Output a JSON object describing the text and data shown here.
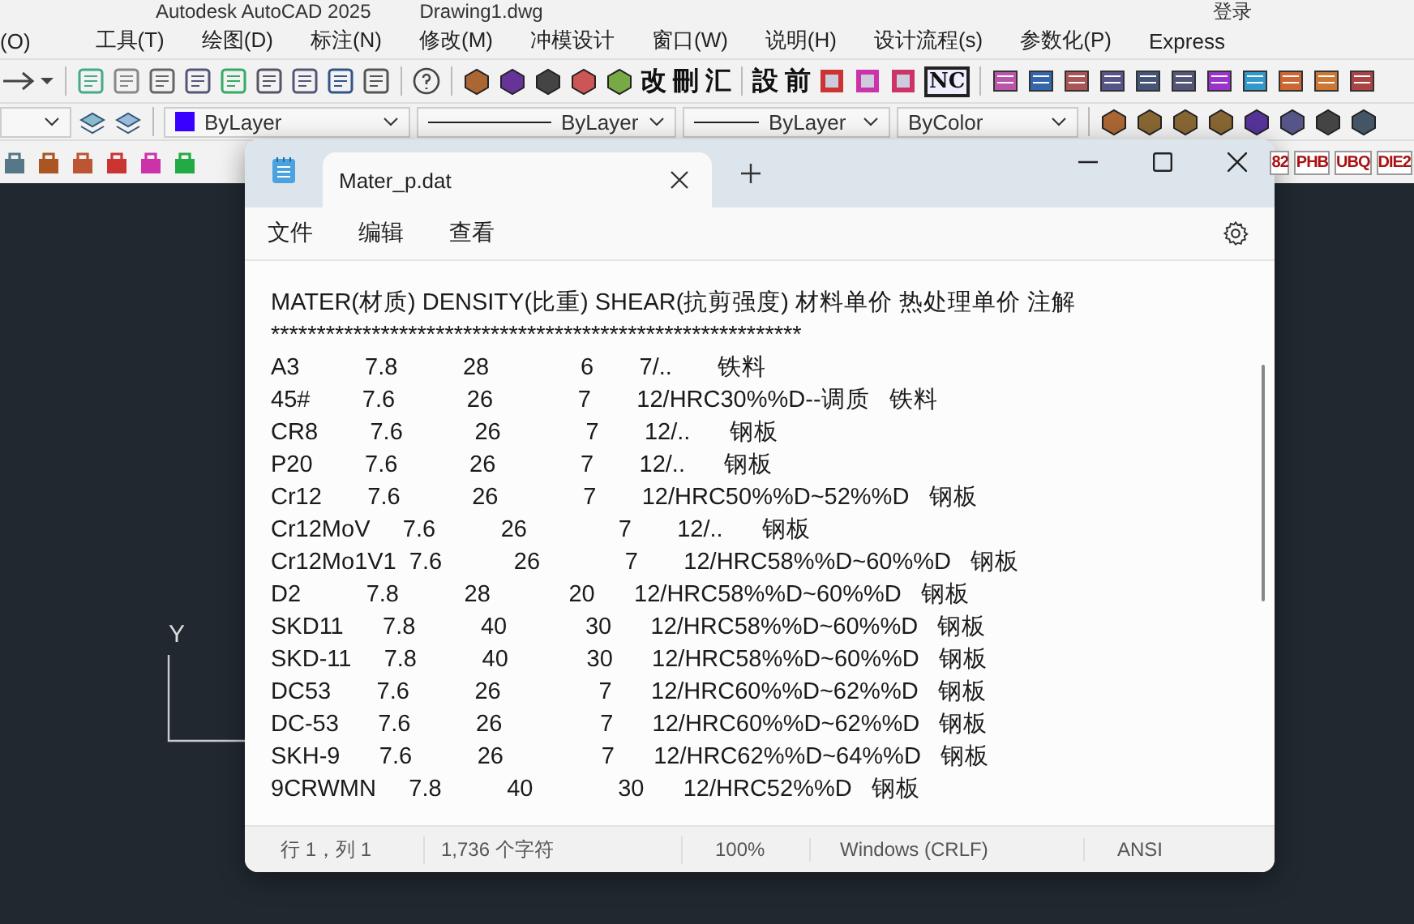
{
  "app": {
    "title": "Autodesk AutoCAD 2025",
    "document": "Drawing1.dwg",
    "user": "登录"
  },
  "menu": [
    "(O)",
    "工具(T)",
    "绘图(D)",
    "标注(N)",
    "修改(M)",
    "冲模设计",
    "窗口(W)",
    "说明(H)",
    "设计流程(s)",
    "参数化(P)",
    "Express"
  ],
  "toolbar_glyphs": [
    "改",
    "刪",
    "汇",
    "設",
    "前",
    "NC"
  ],
  "properties": [
    {
      "kind": "color",
      "value": "ByLayer",
      "color": "#3a00ff"
    },
    {
      "kind": "linetype",
      "value": "ByLayer"
    },
    {
      "kind": "lineweight",
      "value": "ByLayer"
    },
    {
      "kind": "plain",
      "value": "ByColor"
    }
  ],
  "side_glyphs": [
    "82",
    "PHB",
    "UBQ",
    "DIE2"
  ],
  "ucs": {
    "y_label": "Y"
  },
  "notepad": {
    "tabs": [
      {
        "label": "Mater_p.dat",
        "selected": true
      }
    ],
    "menu": [
      "文件",
      "编辑",
      "查看"
    ],
    "lines": [
      "MATER(材质) DENSITY(比重) SHEAR(抗剪强度) 材料单价 热处理单价 注解",
      "**********************************************************",
      "A3          7.8          28              6       7/..       铁料",
      "45#        7.6           26             7       12/HRC30%%D--调质   铁料",
      "CR8        7.6           26             7       12/..      钢板",
      "P20        7.6           26             7       12/..      钢板",
      "Cr12       7.6           26             7       12/HRC50%%D~52%%D   钢板",
      "Cr12MoV     7.6          26              7       12/..      钢板",
      "Cr12Mo1V1  7.6           26             7       12/HRC58%%D~60%%D   钢板",
      "D2          7.8          28            20      12/HRC58%%D~60%%D   钢板",
      "SKD11      7.8          40            30      12/HRC58%%D~60%%D   钢板",
      "SKD-11     7.8          40            30      12/HRC58%%D~60%%D   钢板",
      "DC53       7.6          26               7      12/HRC60%%D~62%%D   钢板",
      "DC-53      7.6          26               7      12/HRC60%%D~62%%D   钢板",
      "SKH-9      7.6          26               7      12/HRC62%%D~64%%D   钢板",
      "9CRWMN     7.8          40             30      12/HRC52%%D   钢板"
    ],
    "status": [
      "行 1，列 1",
      "1,736 个字符",
      "100%",
      "Windows (CRLF)",
      "ANSI"
    ]
  }
}
